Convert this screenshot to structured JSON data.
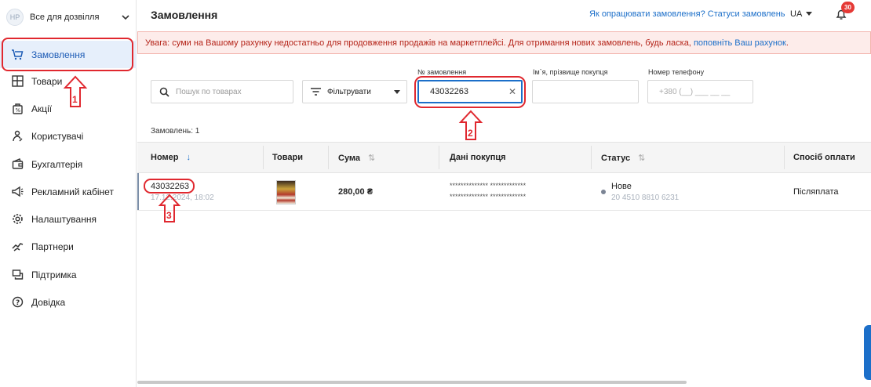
{
  "sidebar": {
    "store": {
      "initials": "HP",
      "name": "Все для дозвілля"
    },
    "items": [
      {
        "label": "Замовлення",
        "icon": "cart-icon",
        "active": true
      },
      {
        "label": "Товари",
        "icon": "grid-icon"
      },
      {
        "label": "Акції",
        "icon": "discount-icon"
      },
      {
        "label": "Користувачі",
        "icon": "users-icon"
      },
      {
        "label": "Бухгалтерія",
        "icon": "wallet-icon"
      },
      {
        "label": "Рекламний кабінет",
        "icon": "megaphone-icon"
      },
      {
        "label": "Налаштування",
        "icon": "gear-icon"
      },
      {
        "label": "Партнери",
        "icon": "handshake-icon"
      },
      {
        "label": "Підтримка",
        "icon": "chat-icon"
      },
      {
        "label": "Довідка",
        "icon": "help-icon"
      }
    ]
  },
  "header": {
    "title": "Замовлення",
    "help_link": "Як опрацювати замовлення? Статуси замовлень",
    "lang": "UA",
    "notifications": "30"
  },
  "warning": {
    "text": "Увага: суми на Вашому рахунку недостатньо для продовження продажів на маркетплейсі. Для отримання нових замовлень, будь ласка, ",
    "link": "поповніть Ваш рахунок",
    "tail": "."
  },
  "filters": {
    "search_placeholder": "Пошук по товарах",
    "filter_button": "Фільтрувати",
    "order_number_label": "№ замовлення",
    "order_number_value": "43032263",
    "buyer_name_label": "Ім`я, прізвище покупця",
    "phone_label": "Номер телефону",
    "phone_placeholder": "+380 (__) ___ __ __"
  },
  "count_text": "Замовлень: 1",
  "table": {
    "columns": [
      "Номер",
      "Товари",
      "Сума",
      "Дані покупця",
      "Статус",
      "Спосіб оплати"
    ],
    "rows": [
      {
        "number": "43032263",
        "date": "17.12.2024, 18:02",
        "sum": "280,00 ₴",
        "buyer_line1": "************** *************",
        "buyer_line2": "************** *************",
        "status": "Нове",
        "ttn": "20 4510 8810 6231",
        "payment": "Післяплата"
      }
    ]
  },
  "annotations": [
    "1",
    "2",
    "3"
  ],
  "colors": {
    "accent": "#1c6fc9",
    "highlight": "#e0282f",
    "warning_bg": "#fdecea"
  }
}
